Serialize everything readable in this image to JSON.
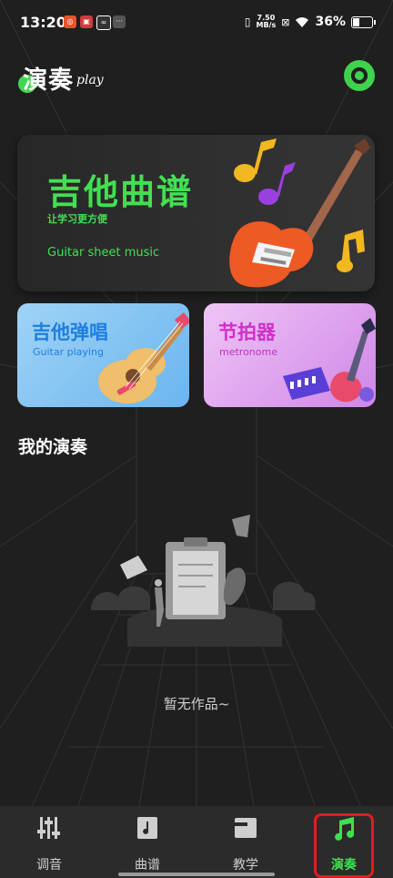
{
  "status_bar": {
    "time": "13:20",
    "net_speed_value": "7.50",
    "net_speed_unit": "MB/s",
    "battery": "36%"
  },
  "header": {
    "logo_text": "演奏",
    "logo_subtext": "play"
  },
  "hero_card": {
    "title": "吉他曲谱",
    "subtitle": "让学习更方便",
    "english": "Guitar sheet music"
  },
  "cards": [
    {
      "title": "吉他弹唱",
      "subtitle": "Guitar playing"
    },
    {
      "title": "节拍器",
      "subtitle": "metronome"
    }
  ],
  "my_performances": {
    "title": "我的演奏",
    "empty_text": "暂无作品~"
  },
  "tabs": [
    {
      "label": "调音",
      "icon": "tuner-sliders-icon",
      "active": false
    },
    {
      "label": "曲谱",
      "icon": "score-book-icon",
      "active": false
    },
    {
      "label": "教学",
      "icon": "teaching-icon",
      "active": false
    },
    {
      "label": "演奏",
      "icon": "music-note-icon",
      "active": true
    }
  ],
  "colors": {
    "accent_green": "#41e052",
    "background": "#1f1f1f",
    "tab_highlight": "#e01e1e"
  }
}
